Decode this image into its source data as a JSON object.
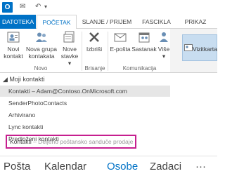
{
  "titlebar": {
    "app_icon": "O",
    "qat": [
      "envelope-icon",
      "undo-icon",
      "dropdown-icon"
    ]
  },
  "tabs": [
    {
      "label": "DATOTEKA"
    },
    {
      "label": "POČETAK"
    },
    {
      "label": "SLANJE / PRIJEM"
    },
    {
      "label": "FASCIKLA"
    },
    {
      "label": "PRIKAZ"
    }
  ],
  "ribbon": {
    "new_contact": "Novi\nkontakt",
    "new_group": "Nova grupa\nkontakata",
    "new_items": "Nove\nstavke ▾",
    "delete": "Izbriši",
    "email": "E-pošta",
    "meeting": "Sastanak",
    "more": "Više\n▾",
    "groups": {
      "new": "Novo",
      "delete": "Brisanje",
      "communication": "Komunikacija"
    }
  },
  "right_pane": {
    "view_label": "Vizitkarta"
  },
  "folders": {
    "header": "◢ Moji kontakti",
    "items": [
      "Kontakti – Adam@Contoso.OnMicrosoft.com",
      "SenderPhotoContacts",
      "Arhivirano",
      "Lync kontakti",
      "Predloženi kontakti"
    ],
    "shared": {
      "name": "Kontakti",
      "detail": "– Deljeno poštansko sanduče prodaje"
    }
  },
  "nav": {
    "mail": "Pošta",
    "calendar": "Kalendar",
    "people": "Osobe",
    "tasks": "Zadaci",
    "more": "···"
  },
  "colors": {
    "accent": "#0072c6",
    "highlight_border": "#c61f8f"
  }
}
